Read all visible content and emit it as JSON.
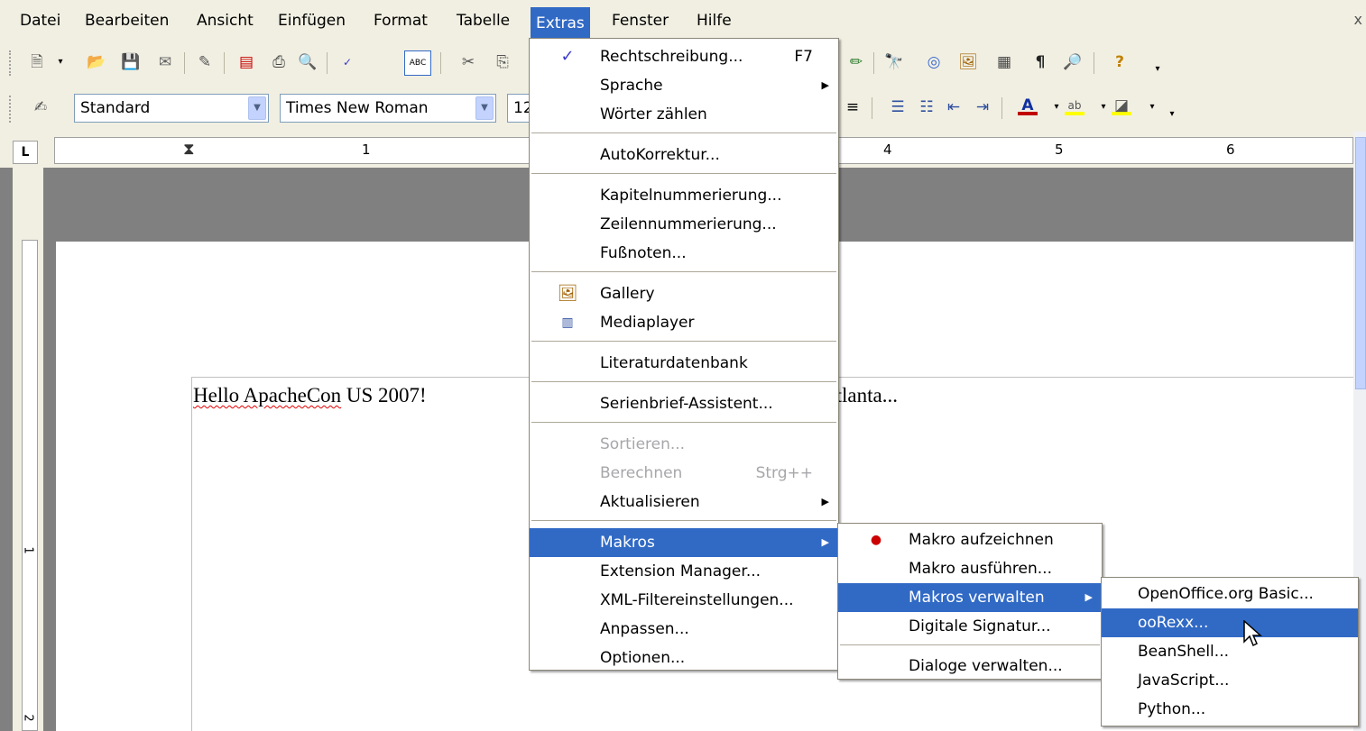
{
  "menubar": {
    "items": [
      {
        "label": "Datei"
      },
      {
        "label": "Bearbeiten"
      },
      {
        "label": "Ansicht"
      },
      {
        "label": "Einfügen"
      },
      {
        "label": "Format"
      },
      {
        "label": "Tabelle"
      },
      {
        "label": "Extras"
      },
      {
        "label": "Fenster"
      },
      {
        "label": "Hilfe"
      }
    ],
    "close_glyph": "x"
  },
  "format_toolbar": {
    "paragraph_style": "Standard",
    "font_name": "Times New Roman",
    "font_size": "12"
  },
  "ruler": {
    "numbers": [
      "1",
      "4",
      "5",
      "6"
    ]
  },
  "vertical_ruler": {
    "numbers": [
      "1",
      "2"
    ]
  },
  "document": {
    "text_part1": "Hello ApacheCon",
    "text_part2": " US 2007! ",
    "text_part3": "Atlanta..."
  },
  "extras_menu": {
    "items": [
      {
        "label": "Rechtschreibung...",
        "shortcut": "F7",
        "icon": "spellcheck-icon"
      },
      {
        "label": "Sprache",
        "submenu": true
      },
      {
        "label": "Wörter zählen"
      },
      {
        "label": "AutoKorrektur..."
      },
      {
        "label": "Kapitelnummerierung..."
      },
      {
        "label": "Zeilennummerierung..."
      },
      {
        "label": "Fußnoten..."
      },
      {
        "label": "Gallery",
        "icon": "gallery-icon"
      },
      {
        "label": "Mediaplayer",
        "icon": "mediaplayer-icon"
      },
      {
        "label": "Literaturdatenbank"
      },
      {
        "label": "Serienbrief-Assistent..."
      },
      {
        "label": "Sortieren...",
        "disabled": true
      },
      {
        "label": "Berechnen",
        "shortcut": "Strg++",
        "disabled": true
      },
      {
        "label": "Aktualisieren",
        "submenu": true
      },
      {
        "label": "Makros",
        "submenu": true,
        "highlighted": true
      },
      {
        "label": "Extension Manager..."
      },
      {
        "label": "XML-Filtereinstellungen..."
      },
      {
        "label": "Anpassen..."
      },
      {
        "label": "Optionen..."
      }
    ]
  },
  "makros_menu": {
    "items": [
      {
        "label": "Makro aufzeichnen",
        "icon": "record-macro-icon"
      },
      {
        "label": "Makro ausführen..."
      },
      {
        "label": "Makros verwalten",
        "submenu": true,
        "highlighted": true
      },
      {
        "label": "Digitale Signatur..."
      },
      {
        "label": "Dialoge verwalten..."
      }
    ]
  },
  "verwalten_menu": {
    "items": [
      {
        "label": "OpenOffice.org Basic..."
      },
      {
        "label": "ooRexx...",
        "highlighted": true
      },
      {
        "label": "BeanShell..."
      },
      {
        "label": "JavaScript..."
      },
      {
        "label": "Python..."
      }
    ]
  },
  "colors": {
    "highlight": "#316ac5",
    "menubar_bg": "#f1efe2",
    "doc_bg": "#808080"
  }
}
